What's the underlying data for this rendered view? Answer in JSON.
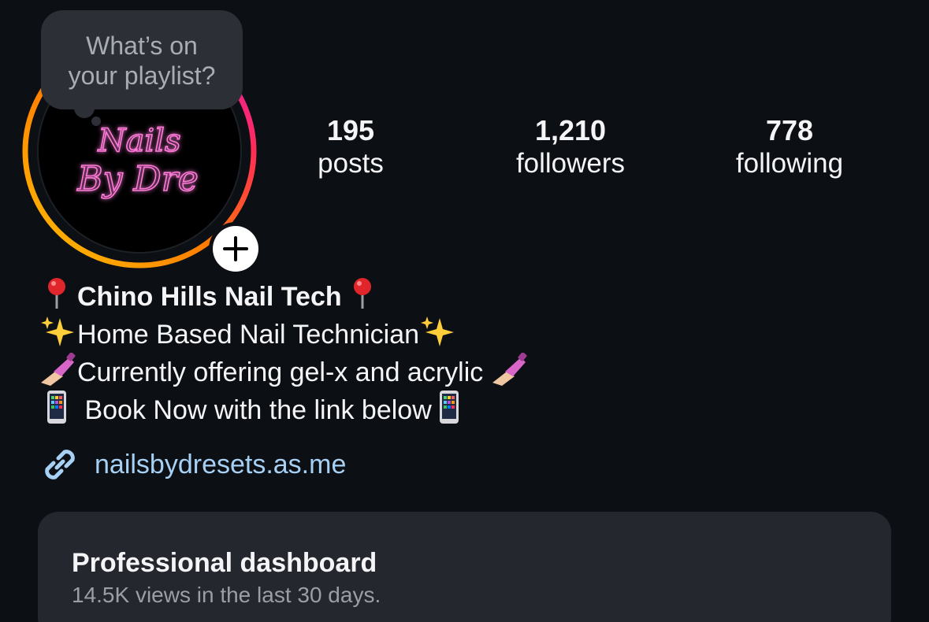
{
  "note": {
    "line1": "What’s on",
    "line2": "your playlist?"
  },
  "avatar": {
    "logo_line1": "Nails",
    "logo_line2": "By Dre",
    "neon_color": "#ff7ad9"
  },
  "stats": {
    "posts": {
      "count": "195",
      "label": "posts"
    },
    "followers": {
      "count": "1,210",
      "label": "followers"
    },
    "following": {
      "count": "778",
      "label": "following"
    }
  },
  "bio": {
    "name": "Chino Hills Nail Tech",
    "line2": "Home Based Nail Technician",
    "line3": "Currently offering gel-x and acrylic ",
    "line4": " Book Now with the link below"
  },
  "link": {
    "text": "nailsbydresets.as.me",
    "color": "#a7d0f5"
  },
  "dashboard": {
    "title": "Professional dashboard",
    "subtitle": "14.5K views in the last 30 days."
  },
  "colors": {
    "background": "#0c0f14",
    "card": "#24272d",
    "bubble": "#2c3036"
  },
  "icons": [
    "round-pushpin-icon",
    "sparkles-icon",
    "nail-polish-icon",
    "mobile-phone-icon",
    "link-icon",
    "plus-icon"
  ]
}
